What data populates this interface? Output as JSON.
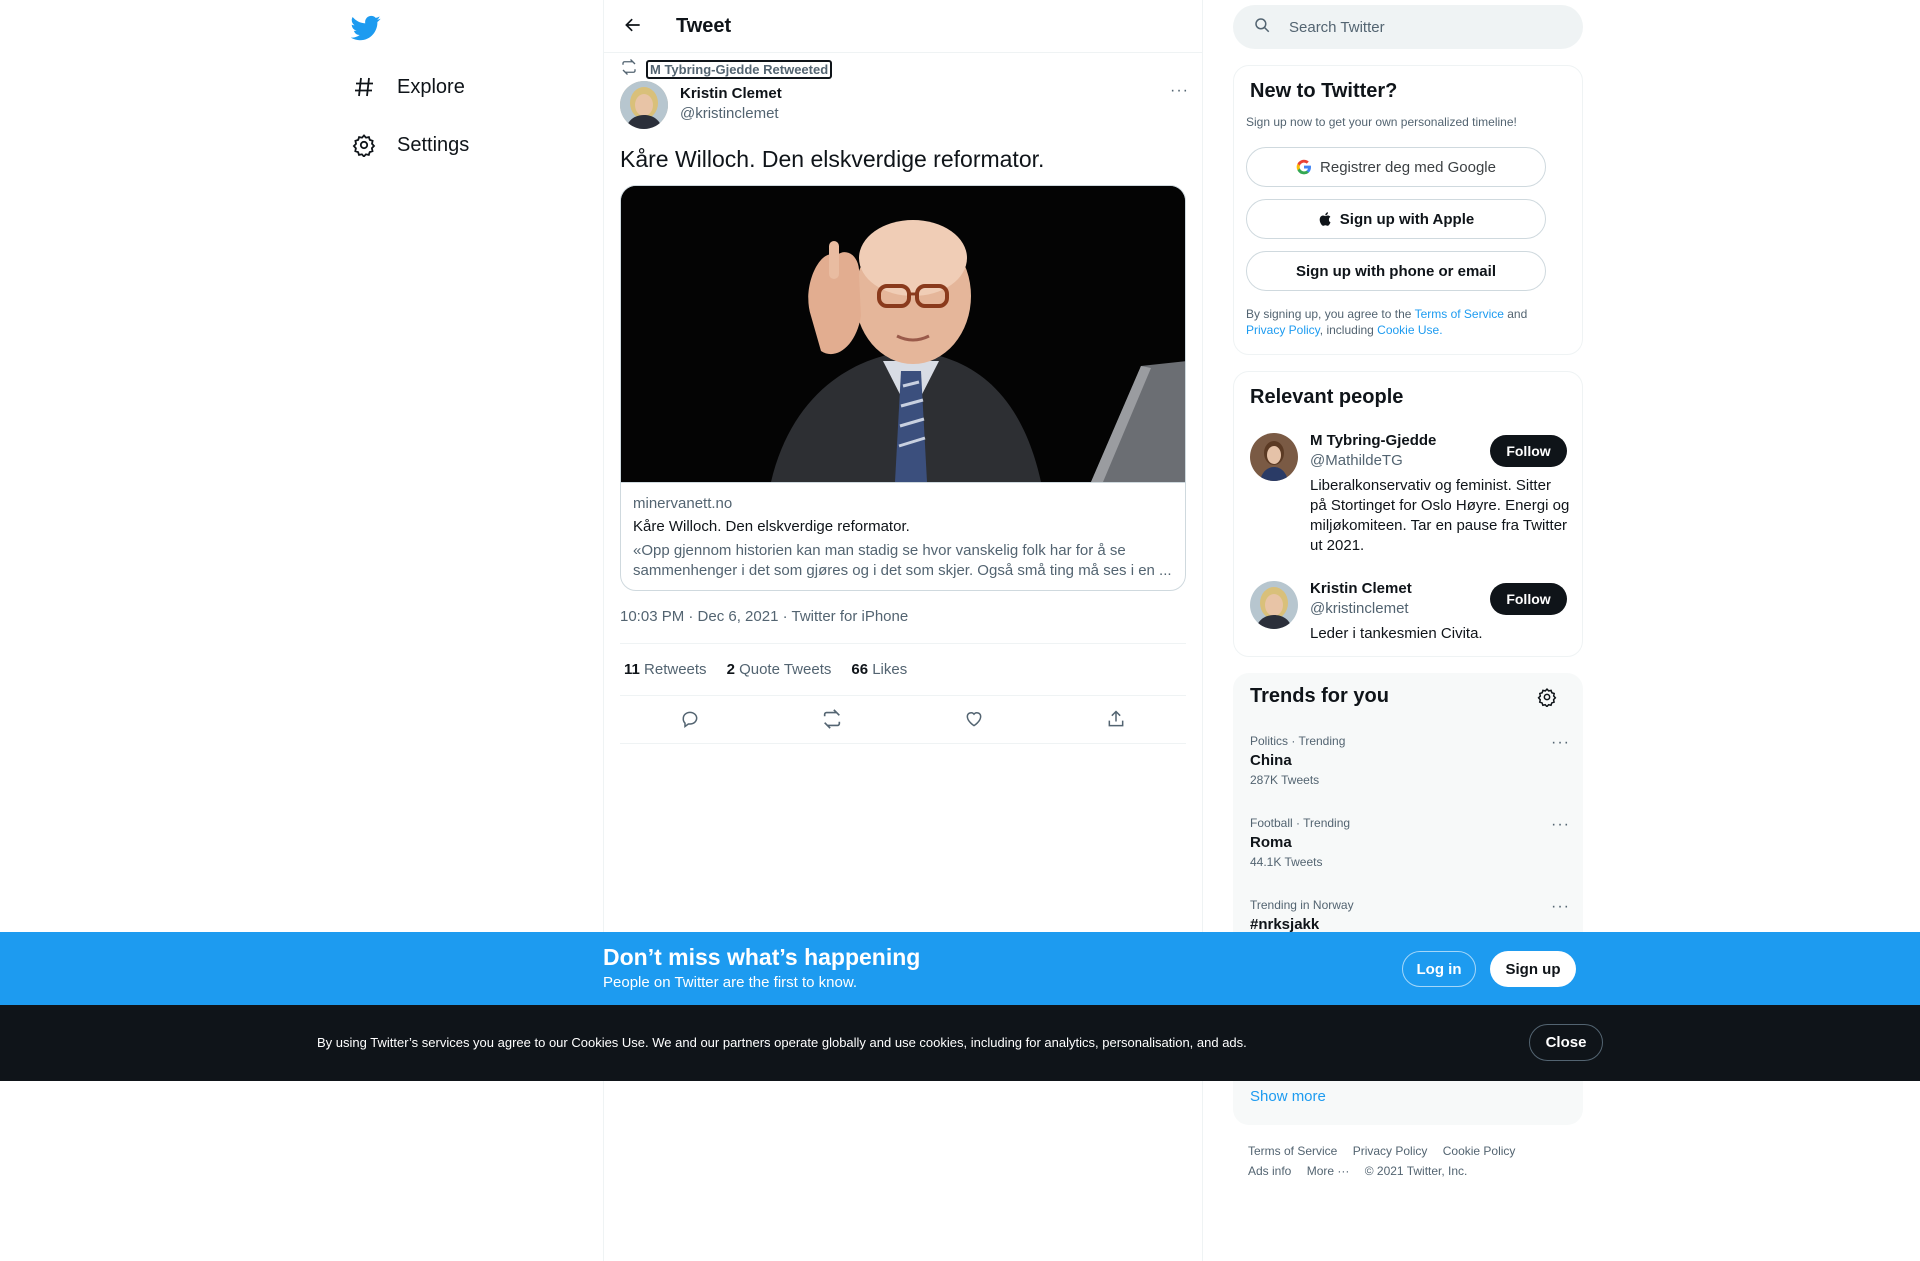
{
  "nav": {
    "logo": "twitter-bird-icon",
    "items": [
      {
        "label": "Explore",
        "icon": "hashtag-icon"
      },
      {
        "label": "Settings",
        "icon": "gear-icon"
      }
    ]
  },
  "header": {
    "title": "Tweet",
    "back_icon": "back-arrow-icon"
  },
  "tweet": {
    "retweeted_by": "M Tybring-Gjedde Retweeted",
    "author_name": "Kristin Clemet",
    "author_handle": "@kristinclemet",
    "text": "Kåre Willoch. Den elskverdige reformator.",
    "card": {
      "domain": "minervanett.no",
      "title": "Kåre Willoch. Den elskverdige reformator.",
      "description": "«Opp gjennom historien kan man stadig se hvor vanskelig folk har for å se sammenhenger i det som gjøres og i det som skjer. Også små ting må ses i en ..."
    },
    "meta": "10:03 PM · Dec 6, 2021 · Twitter for iPhone",
    "stats": {
      "retweets_count": "11",
      "retweets_label": "Retweets",
      "quotes_count": "2",
      "quotes_label": "Quote Tweets",
      "likes_count": "66",
      "likes_label": "Likes"
    }
  },
  "search": {
    "placeholder": "Search Twitter"
  },
  "signup": {
    "title": "New to Twitter?",
    "subtitle": "Sign up now to get your own personalized timeline!",
    "google": "Registrer deg med Google",
    "apple": "Sign up with Apple",
    "email": "Sign up with phone or email",
    "legal_1": "By signing up, you agree to the ",
    "tos": "Terms of Service",
    "legal_and": " and",
    "privacy": "Privacy Policy",
    "legal_including": ", including ",
    "cookie_use": "Cookie Use."
  },
  "people": {
    "title": "Relevant people",
    "items": [
      {
        "name": "M Tybring-Gjedde",
        "handle": "@MathildeTG",
        "bio": "Liberalkonservativ og feminist. Sitter på Stortinget for Oslo Høyre. Energi og miljøkomiteen. Tar en pause fra Twitter ut 2021.",
        "follow": "Follow"
      },
      {
        "name": "Kristin Clemet",
        "handle": "@kristinclemet",
        "bio": "Leder i tankesmien Civita.",
        "follow": "Follow"
      }
    ]
  },
  "trends": {
    "title": "Trends for you",
    "items": [
      {
        "meta": "Politics · Trending",
        "name": "China",
        "count": "287K Tweets"
      },
      {
        "meta": "Football · Trending",
        "name": "Roma",
        "count": "44.1K Tweets"
      },
      {
        "meta": "Trending in Norway",
        "name": "#nrksjakk",
        "count": ""
      }
    ],
    "show_more": "Show more"
  },
  "footer": {
    "tos": "Terms of Service",
    "privacy": "Privacy Policy",
    "cookie": "Cookie Policy",
    "ads": "Ads info",
    "more": "More ···",
    "copyright": "© 2021 Twitter, Inc."
  },
  "banner": {
    "title": "Don’t miss what’s happening",
    "subtitle": "People on Twitter are the first to know.",
    "login": "Log in",
    "signup": "Sign up"
  },
  "cookie_bar": {
    "text": "By using Twitter’s services you agree to our Cookies Use. We and our partners operate globally and use cookies, including for analytics, personalisation, and ads.",
    "close": "Close"
  },
  "colors": {
    "accent": "#1d9bf0",
    "text": "#0f1419",
    "muted": "#536471",
    "dark_bar": "#0f1419"
  }
}
